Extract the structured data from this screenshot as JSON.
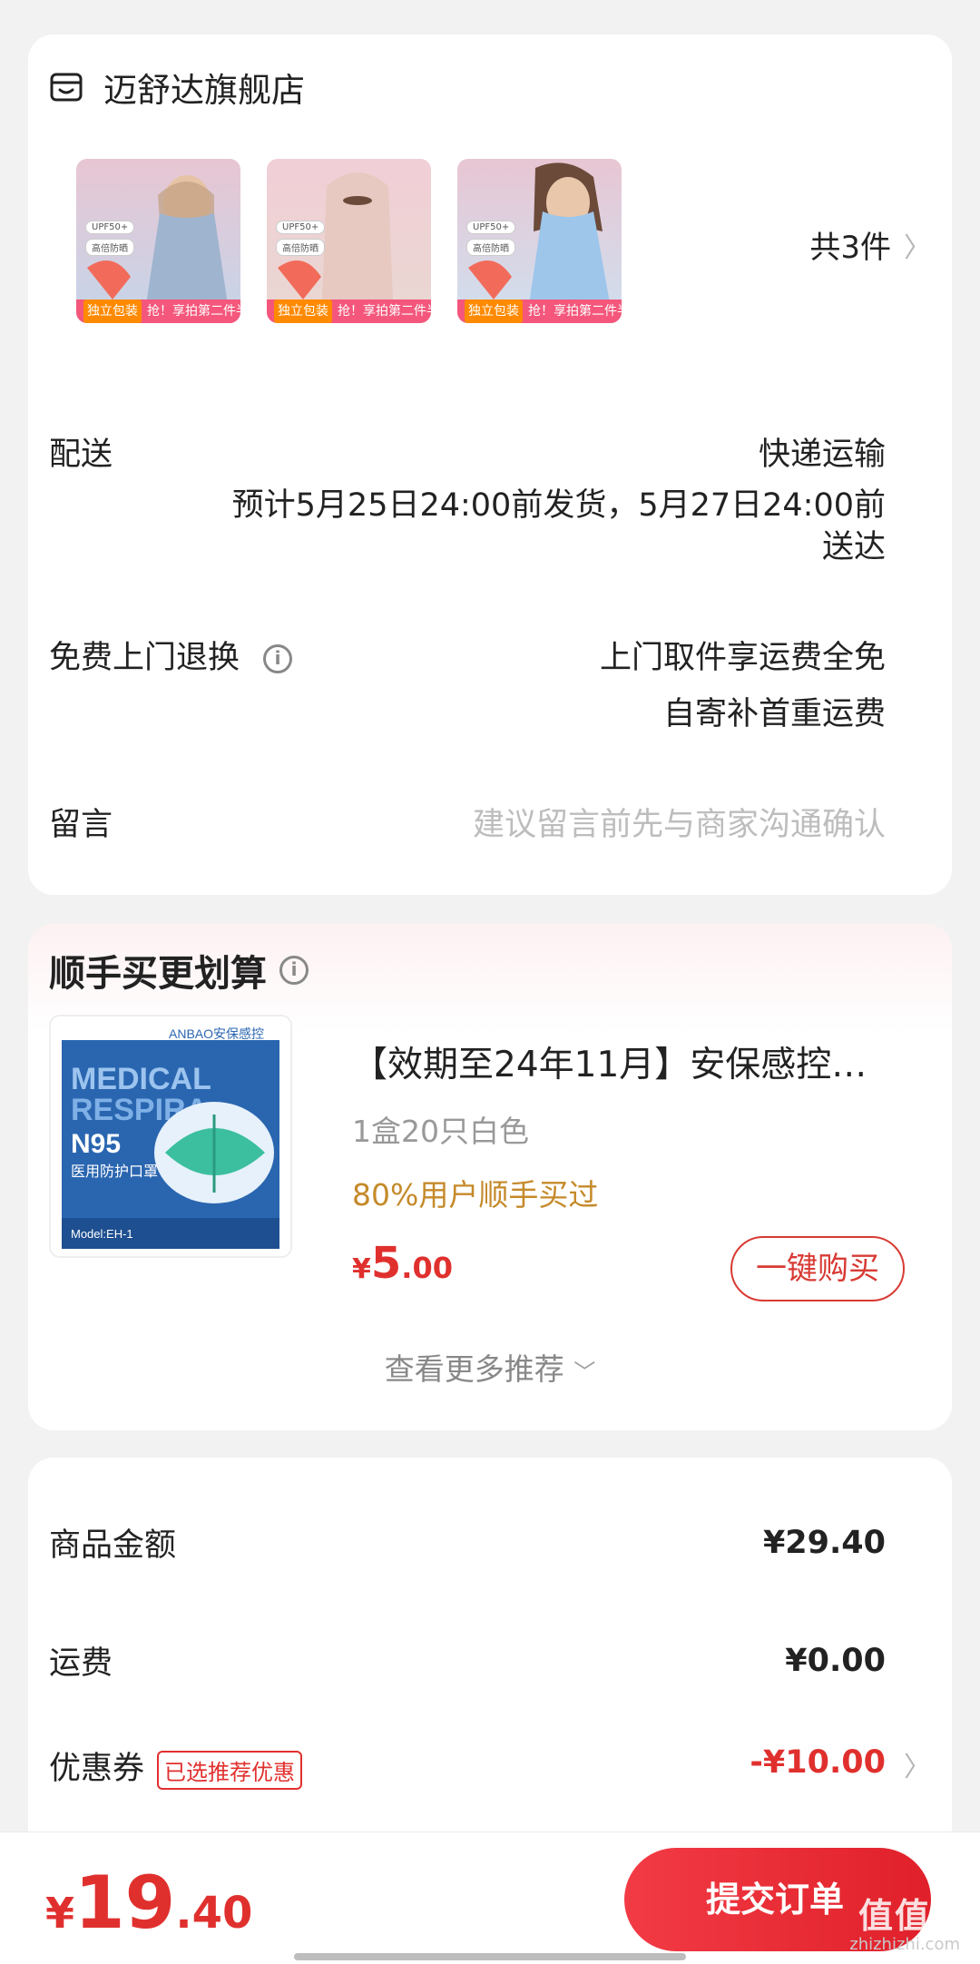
{
  "shop": {
    "name": "迈舒达旗舰店",
    "icon": "shop-icon"
  },
  "items": {
    "count_text": "共3件",
    "thumbs": [
      {
        "tag_pkg": "独立包装",
        "tag_promo": "抢！享拍第二件半价",
        "badge1": "UPF50+",
        "badge2": "高倍防晒",
        "color": "#9fb4cf"
      },
      {
        "tag_pkg": "独立包装",
        "tag_promo": "抢！享拍第二件半价",
        "badge1": "UPF50+",
        "badge2": "高倍防晒",
        "color": "#e7c9c2"
      },
      {
        "tag_pkg": "独立包装",
        "tag_promo": "抢！享拍第二件半价",
        "badge1": "UPF50+",
        "badge2": "高倍防晒",
        "color": "#9ec6ea"
      }
    ]
  },
  "delivery": {
    "label": "配送",
    "method": "快递运输",
    "estimate_line1": "预计5月25日24:00前发货，5月27日24:00前",
    "estimate_line2": "送达"
  },
  "returns": {
    "label": "免费上门退换",
    "line1": "上门取件享运费全免",
    "line2": "自寄补首重运费"
  },
  "message": {
    "label": "留言",
    "placeholder": "建议留言前先与商家沟通确认"
  },
  "recommend": {
    "title": "顺手买更划算",
    "product": {
      "title": "【效期至24年11月】安保感控…",
      "spec": "1盒20只白色",
      "note": "80%用户顺手买过",
      "price_symbol": "¥",
      "price_int": "5",
      "price_dec": ".00",
      "buy_label": "一键购买",
      "image_brand": "ANBAO安保感控",
      "image_text1": "MEDICAL",
      "image_text2": "RESPIRA",
      "image_text3": "N95",
      "image_text4": "医用防护口罩",
      "image_model": "Model:EH-1"
    },
    "more_label": "查看更多推荐"
  },
  "summary": {
    "goods_label": "商品金额",
    "goods_value": "¥29.40",
    "shipping_label": "运费",
    "shipping_value": "¥0.00",
    "coupon_label": "优惠券",
    "coupon_tag": "已选推荐优惠",
    "coupon_value": "-¥10.00"
  },
  "footer": {
    "total_symbol": "¥",
    "total_int": "19",
    "total_dec": ".40",
    "submit_label": "提交订单",
    "watermark": "值值值",
    "watermark_sub": "zhizhizhi.com"
  },
  "colors": {
    "accent": "#e0302e",
    "note": "#c58a2a"
  }
}
